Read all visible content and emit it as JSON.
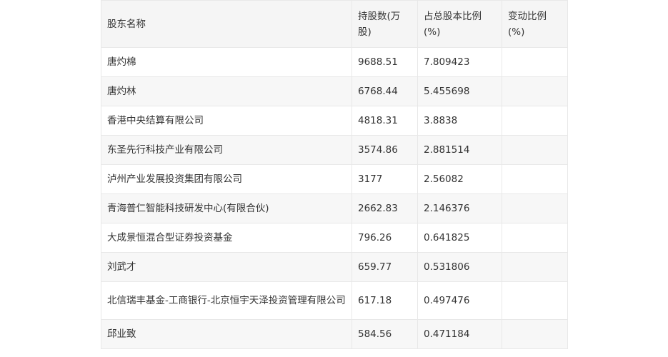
{
  "table": {
    "headers": [
      "股东名称",
      "持股数(万股)",
      "占总股本比例(%)",
      "变动比例(%)"
    ],
    "rows": [
      {
        "name": "唐灼棉",
        "shares": "9688.51",
        "ratio": "7.809423",
        "change": ""
      },
      {
        "name": "唐灼林",
        "shares": "6768.44",
        "ratio": "5.455698",
        "change": ""
      },
      {
        "name": "香港中央结算有限公司",
        "shares": "4818.31",
        "ratio": "3.8838",
        "change": ""
      },
      {
        "name": "东圣先行科技产业有限公司",
        "shares": "3574.86",
        "ratio": "2.881514",
        "change": ""
      },
      {
        "name": "泸州产业发展投资集团有限公司",
        "shares": "3177",
        "ratio": "2.56082",
        "change": ""
      },
      {
        "name": "青海普仁智能科技研发中心(有限合伙)",
        "shares": "2662.83",
        "ratio": "2.146376",
        "change": ""
      },
      {
        "name": "大成景恒混合型证券投资基金",
        "shares": "796.26",
        "ratio": "0.641825",
        "change": ""
      },
      {
        "name": "刘武才",
        "shares": "659.77",
        "ratio": "0.531806",
        "change": ""
      },
      {
        "name": "北信瑞丰基金-工商银行-北京恒宇天泽投资管理有限公司",
        "shares": "617.18",
        "ratio": "0.497476",
        "change": ""
      },
      {
        "name": "邱业致",
        "shares": "584.56",
        "ratio": "0.471184",
        "change": ""
      }
    ]
  }
}
